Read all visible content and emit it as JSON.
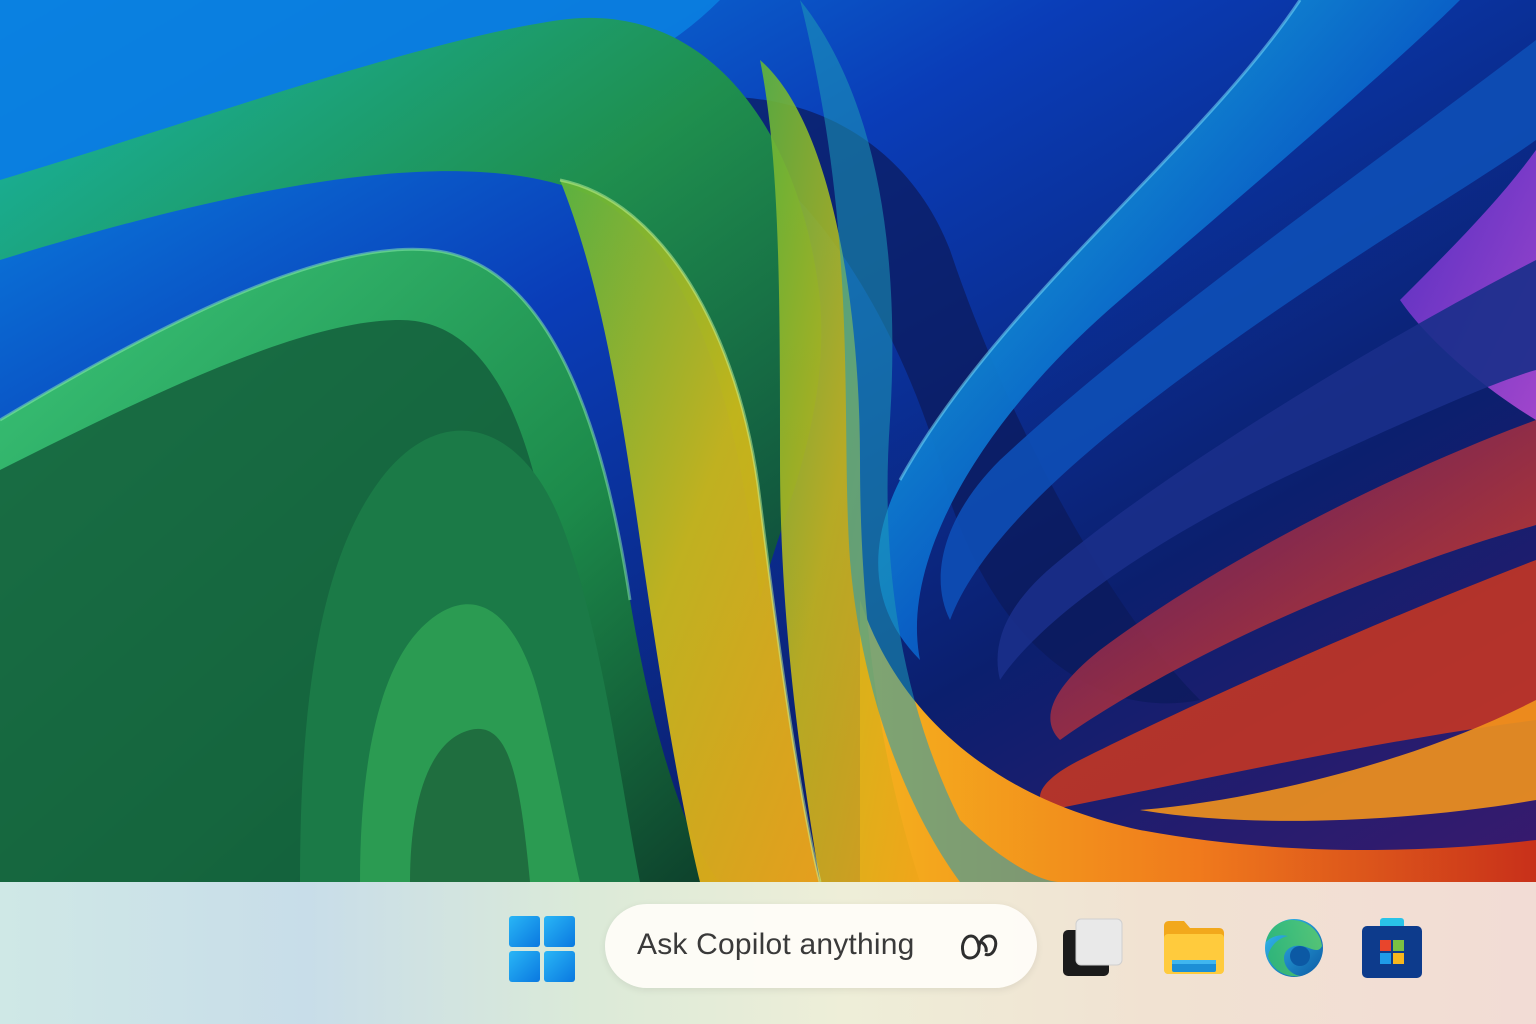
{
  "desktop": {
    "wallpaper": {
      "description_colors": [
        "#0a3db8",
        "#17a9c9",
        "#2fae5a",
        "#f2b21b",
        "#e8541d",
        "#7a2aa8"
      ]
    }
  },
  "taskbar": {
    "start": {
      "icon": "windows-logo-icon",
      "color": "#0a78e0"
    },
    "search": {
      "placeholder": "Ask Copilot anything",
      "icon": "copilot-icon"
    },
    "apps": [
      {
        "icon": "task-view-icon"
      },
      {
        "icon": "file-explorer-icon"
      },
      {
        "icon": "edge-browser-icon"
      },
      {
        "icon": "microsoft-store-icon"
      }
    ]
  }
}
